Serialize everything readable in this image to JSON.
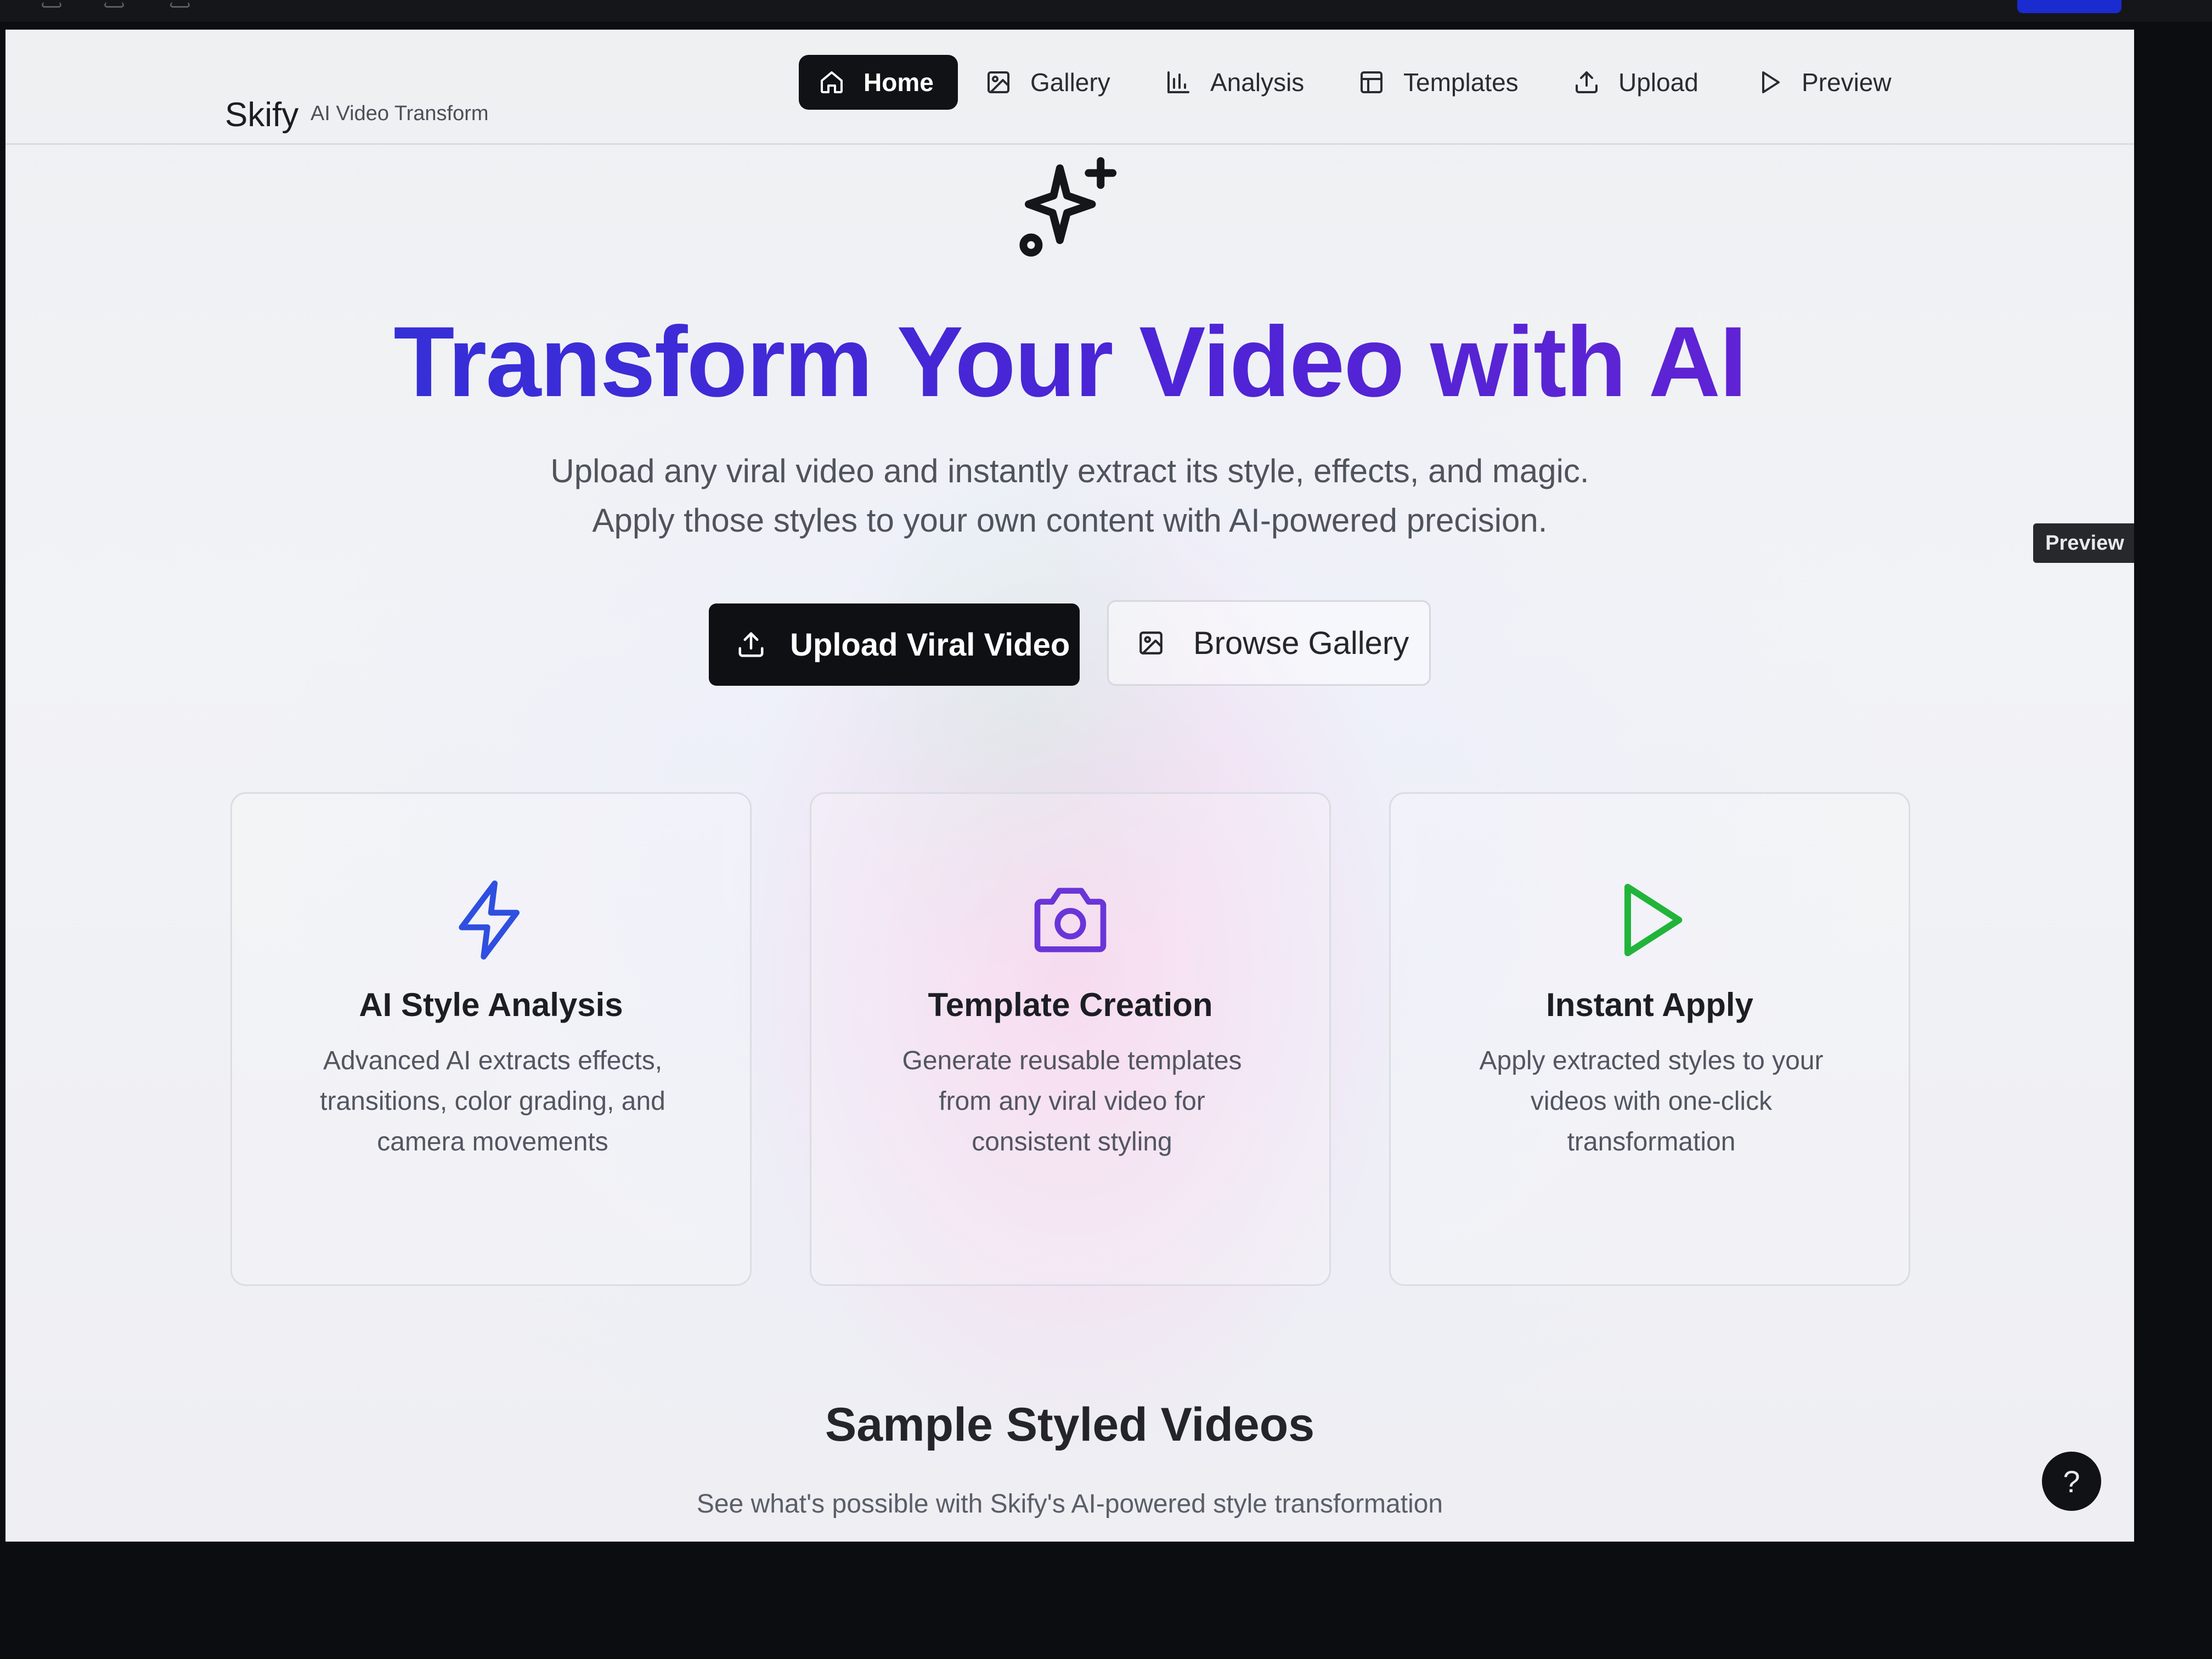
{
  "brand": {
    "name": "Skify",
    "tagline": "AI Video Transform"
  },
  "nav": {
    "items": [
      {
        "label": "Home",
        "icon": "home-icon",
        "active": true
      },
      {
        "label": "Gallery",
        "icon": "image-icon",
        "active": false
      },
      {
        "label": "Analysis",
        "icon": "bar-chart-icon",
        "active": false
      },
      {
        "label": "Templates",
        "icon": "layout-icon",
        "active": false
      },
      {
        "label": "Upload",
        "icon": "upload-icon",
        "active": false
      },
      {
        "label": "Preview",
        "icon": "play-icon",
        "active": false
      }
    ]
  },
  "side_tab": {
    "label": "Preview"
  },
  "hero": {
    "icon": "sparkles-icon",
    "title": "Transform Your Video with AI",
    "subtitle_line1": "Upload any viral video and instantly extract its style, effects, and magic.",
    "subtitle_line2": "Apply those styles to your own content with AI-powered precision.",
    "primary_button": {
      "label": "Upload Viral Video",
      "icon": "upload-icon"
    },
    "secondary_button": {
      "label": "Browse Gallery",
      "icon": "image-icon"
    }
  },
  "features": [
    {
      "title": "AI Style Analysis",
      "description": "Advanced AI extracts effects, transitions, color grading, and camera movements",
      "icon": "zap-icon",
      "color": "#2f4fe0"
    },
    {
      "title": "Template Creation",
      "description": "Generate reusable templates from any viral video for consistent styling",
      "icon": "camera-icon",
      "color": "#6a35d8"
    },
    {
      "title": "Instant Apply",
      "description": "Apply extracted styles to your videos with one-click transformation",
      "icon": "play-icon",
      "color": "#22b43a"
    }
  ],
  "samples": {
    "title": "Sample Styled Videos",
    "subtitle": "See what's possible with Skify's AI-powered style transformation"
  },
  "help": {
    "label": "?"
  },
  "colors": {
    "accent_start": "#2a35d8",
    "accent_end": "#6c22d2",
    "primary_button_bg": "#0f1014"
  }
}
